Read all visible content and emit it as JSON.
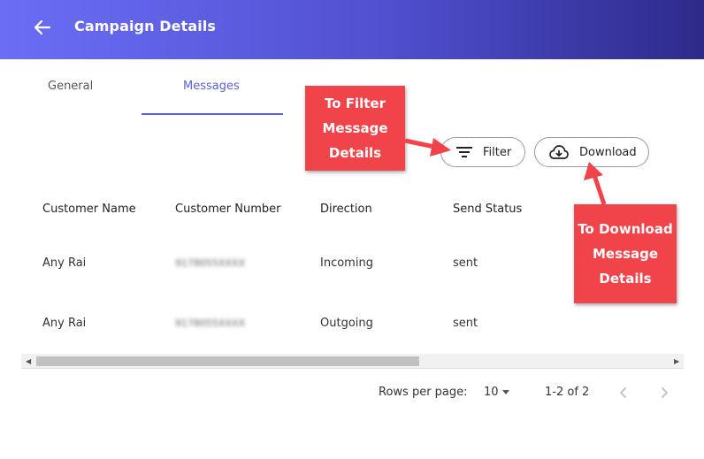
{
  "header": {
    "title": "Campaign Details",
    "back_icon": "arrow-left-icon"
  },
  "tabs": [
    {
      "label": "General",
      "active": false
    },
    {
      "label": "Messages",
      "active": true
    }
  ],
  "toolbar": {
    "filter_label": "Filter",
    "download_label": "Download"
  },
  "callouts": {
    "filter": [
      "To Filter",
      "Message",
      "Details"
    ],
    "download": [
      "To Download",
      "Message",
      "Details"
    ]
  },
  "table": {
    "columns": [
      "Customer Name",
      "Customer Number",
      "Direction",
      "Send Status"
    ],
    "rows": [
      [
        "Any Rai",
        "9178055XXXX",
        "Incoming",
        "sent"
      ],
      [
        "Any Rai",
        "9178055XXXX",
        "Outgoing",
        "sent"
      ]
    ]
  },
  "pagination": {
    "rows_per_page_label": "Rows per page:",
    "rows_per_page": "10",
    "range": "1-2 of 2"
  },
  "colors": {
    "accent": "#5a5fd6",
    "callout": "#f0434a",
    "header_start": "#6b6ef5",
    "header_end": "#2e2a8a"
  }
}
